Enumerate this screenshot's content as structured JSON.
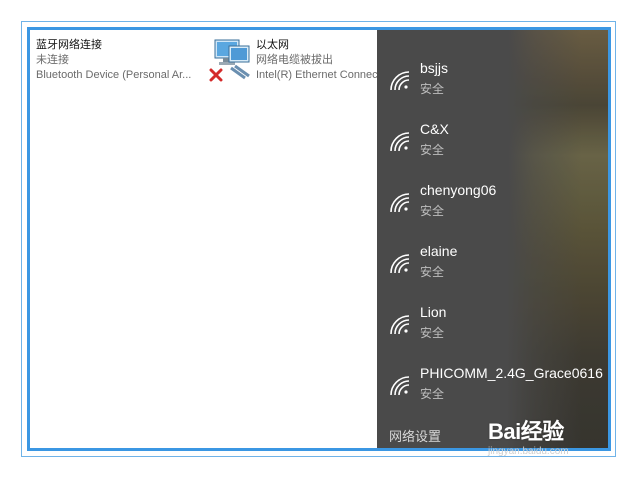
{
  "connections": [
    {
      "name": "蓝牙网络连接",
      "status": "未连接",
      "device": "Bluetooth Device (Personal Ar..."
    },
    {
      "name": "以太网",
      "status": "网络电缆被拔出",
      "device": "Intel(R) Ethernet Connec"
    }
  ],
  "wifi": {
    "networks": [
      {
        "ssid": "bsjjs",
        "security": "安全"
      },
      {
        "ssid": "C&X",
        "security": "安全"
      },
      {
        "ssid": "chenyong06",
        "security": "安全"
      },
      {
        "ssid": "elaine",
        "security": "安全"
      },
      {
        "ssid": "Lion",
        "security": "安全"
      },
      {
        "ssid": "PHICOMM_2.4G_Grace0616",
        "security": "安全"
      }
    ],
    "settings_label": "网络设置"
  },
  "watermark": {
    "logo": "Bai经验",
    "url": "jingyan.baidu.com"
  },
  "colors": {
    "frame": "#3b97e3",
    "flyout": "#4a4a4a",
    "text_primary": "#ffffff",
    "text_secondary": "#bdbdbd"
  }
}
